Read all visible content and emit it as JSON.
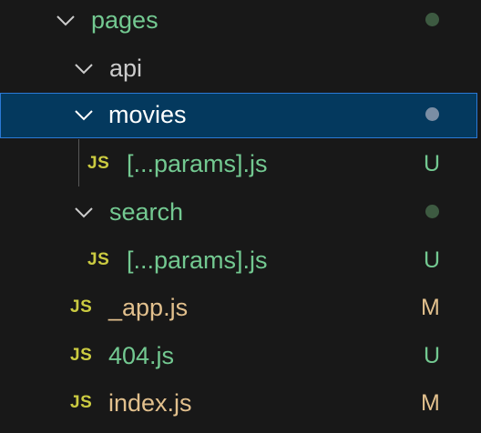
{
  "explorer": {
    "rows": [
      {
        "label": "pages",
        "decoration": "dot",
        "decoration_color": "#3d5a41"
      },
      {
        "label": "api"
      },
      {
        "label": "movies",
        "decoration": "dot",
        "decoration_color": "#7b8ea4",
        "selected": true
      },
      {
        "icon": "JS",
        "label": "[...params].js",
        "badge": "U"
      },
      {
        "label": "search",
        "decoration": "dot",
        "decoration_color": "#3d5a41"
      },
      {
        "icon": "JS",
        "label": "[...params].js",
        "badge": "U"
      },
      {
        "icon": "JS",
        "label": "_app.js",
        "badge": "M"
      },
      {
        "icon": "JS",
        "label": "404.js",
        "badge": "U"
      },
      {
        "icon": "JS",
        "label": "index.js",
        "badge": "M"
      }
    ]
  },
  "colors": {
    "untracked": "#73c991",
    "modified": "#e2c08d",
    "folder_plain": "#cccccc",
    "js_icon": "#cbcb41",
    "selection_bg": "#04395e",
    "selection_border": "#2b79d6"
  }
}
